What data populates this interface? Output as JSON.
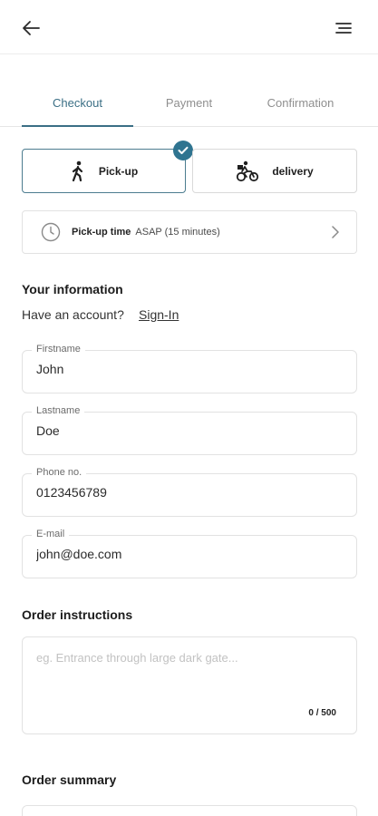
{
  "header": {
    "back_icon": "arrow-left-icon",
    "menu_icon": "menu-lines-icon"
  },
  "tabs": [
    {
      "label": "Checkout",
      "active": true
    },
    {
      "label": "Payment",
      "active": false
    },
    {
      "label": "Confirmation",
      "active": false
    }
  ],
  "delivery_method": {
    "pickup": {
      "label": "Pick-up",
      "icon": "walking-person-icon",
      "selected": true
    },
    "delivery": {
      "label": "delivery",
      "icon": "cyclist-icon",
      "selected": false
    }
  },
  "pickup_time": {
    "label": "Pick-up time",
    "value": "ASAP (15 minutes)",
    "icon": "clock-icon"
  },
  "your_information": {
    "title": "Your information",
    "have_account": "Have an account?",
    "sign_in": "Sign-In",
    "fields": [
      {
        "label": "Firstname",
        "value": "John"
      },
      {
        "label": "Lastname",
        "value": "Doe"
      },
      {
        "label": "Phone no.",
        "value": "0123456789"
      },
      {
        "label": "E-mail",
        "value": "john@doe.com"
      }
    ]
  },
  "order_instructions": {
    "title": "Order instructions",
    "placeholder": "eg. Entrance through large dark gate...",
    "counter": "0 / 500"
  },
  "order_summary": {
    "title": "Order summary"
  },
  "colors": {
    "accent": "#2f7490",
    "tab_active": "#3b6f85",
    "border": "#e2e2e2"
  }
}
